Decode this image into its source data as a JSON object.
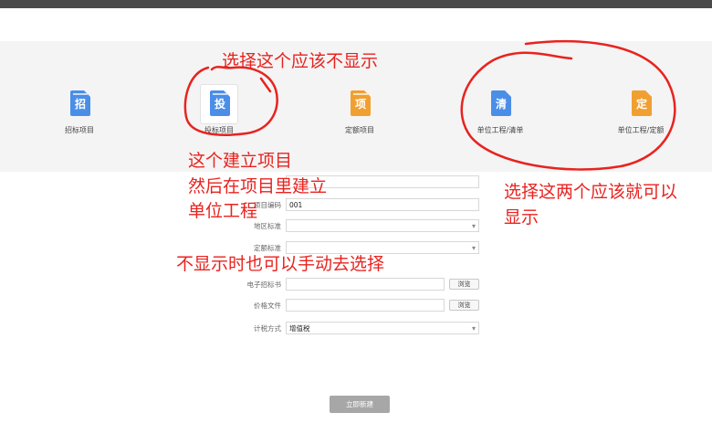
{
  "project_types": [
    {
      "label": "招标项目",
      "glyph": "招",
      "color": "#4a8ee8",
      "icon": "bid-invitation-document-icon",
      "selected": false
    },
    {
      "label": "投标项目",
      "glyph": "投",
      "color": "#4a8ee8",
      "icon": "tender-document-icon",
      "selected": true
    },
    {
      "label": "定额项目",
      "glyph": "项",
      "color": "#f0a030",
      "icon": "quota-project-document-icon",
      "selected": false
    },
    {
      "label": "单位工程/清单",
      "glyph": "清",
      "color": "#4a8ee8",
      "icon": "unit-project-bill-document-icon",
      "selected": false
    },
    {
      "label": "单位工程/定额",
      "glyph": "定",
      "color": "#f0a030",
      "icon": "unit-project-quota-document-icon",
      "selected": false
    }
  ],
  "form": {
    "project_name_value": "",
    "project_code_label": "项目编码",
    "project_code_value": "001",
    "region_label": "地区标准",
    "region_value": "",
    "quota_label": "定额标准",
    "quota_value": "",
    "e_bid_label": "电子招标书",
    "e_bid_value": "",
    "price_file_label": "价格文件",
    "price_file_value": "",
    "tax_label": "计税方式",
    "tax_value": "增值税",
    "browse_label": "浏览"
  },
  "create_button_label": "立即新建",
  "annotations": {
    "top": "选择这个应该不显示",
    "left_line1": "这个建立项目",
    "left_line2": "然后在项目里建立",
    "left_line3": "单位工程",
    "right_line1": "选择这两个应该就可以",
    "right_line2": "显示",
    "middle": "不显示时也可以手动去选择"
  },
  "colors": {
    "annotation": "#e8231f",
    "blue_icon": "#4a8ee8",
    "orange_icon": "#f0a030",
    "create_button": "#a7a7a7"
  }
}
